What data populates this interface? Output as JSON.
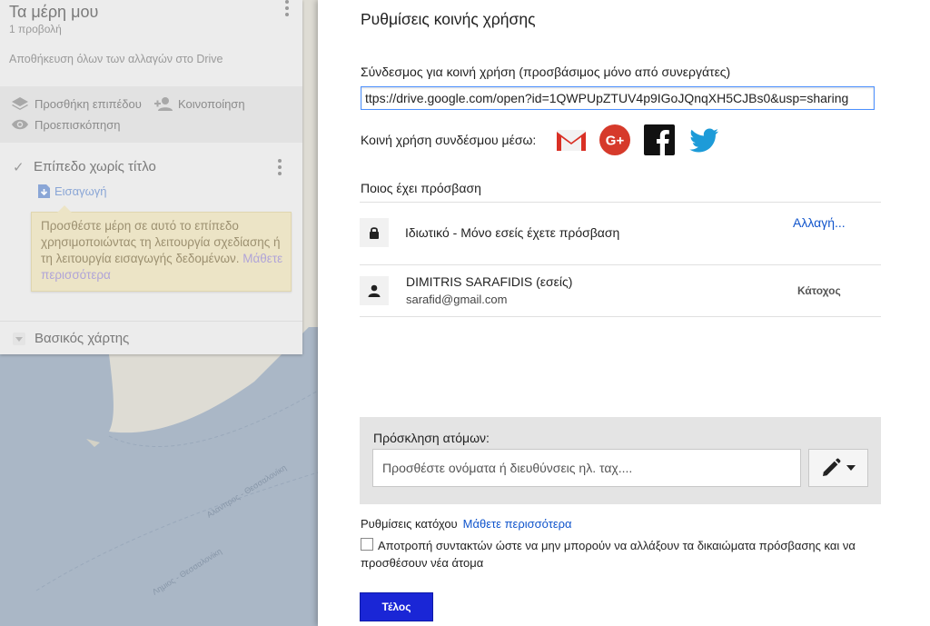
{
  "left_panel": {
    "title": "Τα μέρη μου",
    "views": "1 προβολή",
    "save_status": "Αποθήκευση όλων των αλλαγών στο Drive",
    "add_layer": "Προσθήκη επιπέδου",
    "share": "Κοινοποίηση",
    "preview": "Προεπισκόπηση",
    "layer_name": "Επίπεδο χωρίς τίτλο",
    "import": "Εισαγωγή",
    "hint_text": "Προσθέστε μέρη σε αυτό το επίπεδο χρησιμοποιώντας τη λειτουργία σχεδίασης ή τη λειτουργία εισαγωγής δεδομένων.",
    "hint_link": "Μάθετε περισσότερα",
    "base_map": "Βασικός χάρτης"
  },
  "modal": {
    "title": "Ρυθμίσεις κοινής χρήσης",
    "link_label": "Σύνδεσμος για κοινή χρήση (προσβάσιμος μόνο από συνεργάτες)",
    "link_value": "ttps://drive.google.com/open?id=1QWPUpZTUV4p9IGoJQnqXH5CJBs0&usp=sharing",
    "share_via_label": "Κοινή χρήση συνδέσμου μέσω:",
    "share_services": [
      "gmail-icon",
      "google-plus-icon",
      "facebook-icon",
      "twitter-icon"
    ],
    "who_has_access": "Ποιος έχει πρόσβαση",
    "access_level": "Ιδιωτικό - Μόνο εσείς έχετε πρόσβαση",
    "change_link": "Αλλαγή...",
    "owner_name": "DIMITRIS SARAFIDIS (εσείς)",
    "owner_email": "sarafid@gmail.com",
    "owner_role": "Κάτοχος",
    "invite_label": "Πρόσκληση ατόμων:",
    "invite_placeholder": "Προσθέστε ονόματα ή διευθύνσεις ηλ. ταχ....",
    "owner_settings_label": "Ρυθμίσεις κατόχου",
    "owner_settings_link": "Μάθετε περισσότερα",
    "restrict_text": "Αποτροπή συντακτών ώστε να μην μπορούν να αλλάξουν τα δικαιώματα πρόσβασης και να προσθέσουν νέα άτομα",
    "done_label": "Τέλος"
  },
  "map": {
    "road_label_1": "Αλανπρος - Θεσσαλονίκη",
    "road_label_2": "Λημιος - Θεσσαλονίκη",
    "land_color": "#dedcd4",
    "water_color": "#aab7c6"
  },
  "colors": {
    "link": "#1155cc",
    "primary_button": "#1a26d6",
    "input_focus": "#4d90fe"
  }
}
